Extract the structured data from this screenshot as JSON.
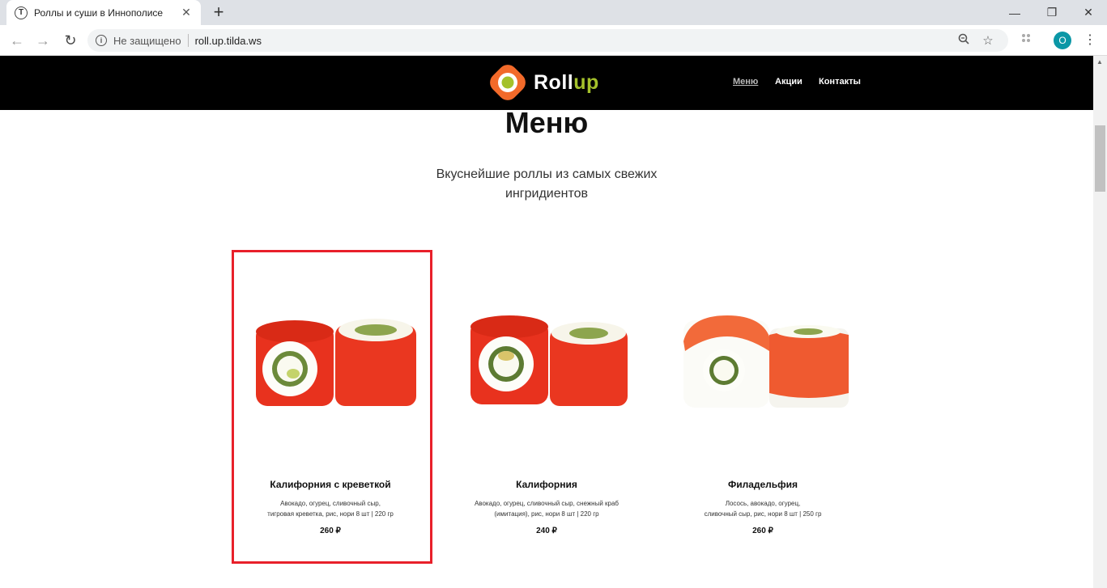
{
  "browser": {
    "tab_title": "Роллы и суши в Иннополисе",
    "tab_favicon": "T",
    "new_tab": "+",
    "insecure_label": "Не защищено",
    "url": "roll.up.tilda.ws",
    "profile_initial": "O"
  },
  "site": {
    "logo_main": "Roll",
    "logo_accent": "up",
    "nav": [
      {
        "label": "Меню",
        "active": true
      },
      {
        "label": "Акции",
        "active": false
      },
      {
        "label": "Контакты",
        "active": false
      }
    ],
    "title": "Меню",
    "subtitle": "Вкуснейшие роллы из самых свежих ингридиентов"
  },
  "products": [
    {
      "name": "Калифорния с креветкой",
      "desc_line1": "Авокадо, огурец, сливочный сыр,",
      "desc_line2": "тигровая креветка, рис, нори 8 шт | 220 гр",
      "price": "260 ₽",
      "color": "#e8321e"
    },
    {
      "name": "Калифорния",
      "desc_line1": "Авокадо, огурец, сливочный сыр, снежный краб",
      "desc_line2": "(имитация), рис, нори 8 шт | 220 гр",
      "price": "240 ₽",
      "color": "#e8321e"
    },
    {
      "name": "Филадельфия",
      "desc_line1": "Лосось, авокадо, огурец,",
      "desc_line2": "сливочный сыр, рис, нори 8 шт | 250 гр",
      "price": "260 ₽",
      "color": "#f26a3a"
    }
  ],
  "colors": {
    "header_bg": "#000000",
    "accent_green": "#a4c12b",
    "logo_orange": "#f26a2a",
    "highlight_red": "#e8202a"
  }
}
